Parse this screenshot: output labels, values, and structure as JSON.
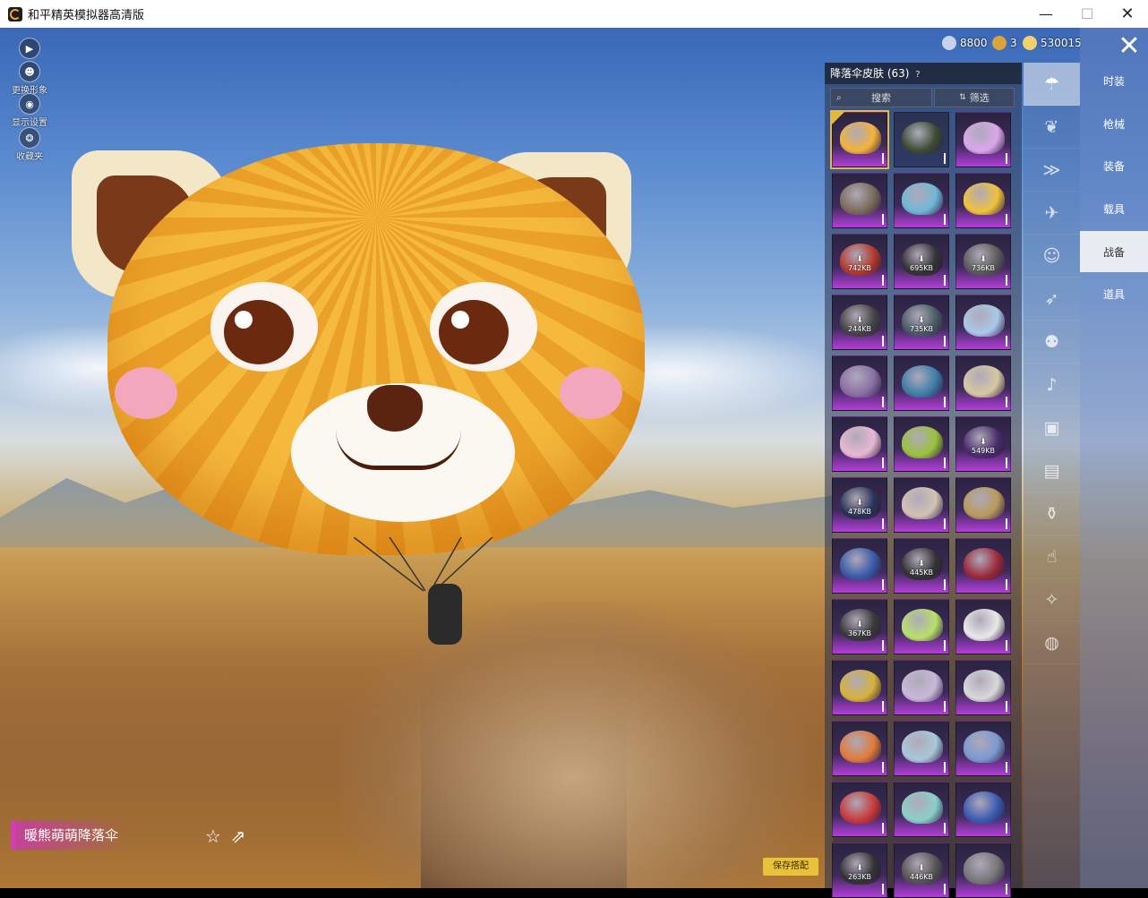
{
  "window": {
    "title": "和平精英模拟器高清版"
  },
  "currencies": [
    {
      "value": "8800",
      "color": "#c9d3e8"
    },
    {
      "value": "3",
      "color": "#d8a53a"
    },
    {
      "value": "530015",
      "color": "#f0d26a"
    }
  ],
  "left_tools": [
    {
      "label": "",
      "icon": "play-icon"
    },
    {
      "label": "更换形象",
      "icon": "person-icon"
    },
    {
      "label": "显示设置",
      "icon": "eye-icon"
    },
    {
      "label": "收藏夹",
      "icon": "badge-icon"
    }
  ],
  "panel": {
    "title": "降落伞皮肤 (63)",
    "help": "?",
    "search_label": "搜索",
    "filter_label": "筛选",
    "tiles": [
      {
        "size": "",
        "color": "#f2b33a",
        "selected": true
      },
      {
        "size": "",
        "color": "#3e4a33"
      },
      {
        "size": "",
        "color": "#d9a7e8"
      },
      {
        "size": "",
        "color": "#7a6b5a"
      },
      {
        "size": "",
        "color": "#6fb8d6"
      },
      {
        "size": "",
        "color": "#f0c23a"
      },
      {
        "size": "742KB",
        "color": "#b33a2e"
      },
      {
        "size": "695KB",
        "color": "#333"
      },
      {
        "size": "736KB",
        "color": "#5b5b5b"
      },
      {
        "size": "244KB",
        "color": "#444"
      },
      {
        "size": "735KB",
        "color": "#4a5c66"
      },
      {
        "size": "",
        "color": "#a8c8e8"
      },
      {
        "size": "",
        "color": "#8a6fa5"
      },
      {
        "size": "",
        "color": "#3e7ea8"
      },
      {
        "size": "",
        "color": "#d6c8a0"
      },
      {
        "size": "",
        "color": "#e8b7d2"
      },
      {
        "size": "",
        "color": "#9ac23a"
      },
      {
        "size": "549KB",
        "color": "#4a2d6b"
      },
      {
        "size": "478KB",
        "color": "#2a3355"
      },
      {
        "size": "",
        "color": "#d2c2b2"
      },
      {
        "size": "",
        "color": "#b89a5a"
      },
      {
        "size": "",
        "color": "#3a5aa8"
      },
      {
        "size": "445KB",
        "color": "#333"
      },
      {
        "size": "",
        "color": "#9a2a3a"
      },
      {
        "size": "367KB",
        "color": "#3a3a3a"
      },
      {
        "size": "",
        "color": "#b8e06a"
      },
      {
        "size": "",
        "color": "#e8e8e8"
      },
      {
        "size": "",
        "color": "#d6b23a"
      },
      {
        "size": "",
        "color": "#c8b8d8"
      },
      {
        "size": "",
        "color": "#d8d8d8"
      },
      {
        "size": "",
        "color": "#e07a3a"
      },
      {
        "size": "",
        "color": "#a8c8d8"
      },
      {
        "size": "",
        "color": "#7a9ad0"
      },
      {
        "size": "",
        "color": "#c83a3a"
      },
      {
        "size": "",
        "color": "#8ad0c8"
      },
      {
        "size": "",
        "color": "#3a5ab0"
      },
      {
        "size": "263KB",
        "color": "#333"
      },
      {
        "size": "446KB",
        "color": "#555"
      },
      {
        "size": "",
        "color": "#777"
      }
    ]
  },
  "rail": [
    {
      "icon": "parachute-icon",
      "active": true
    },
    {
      "icon": "wings-icon"
    },
    {
      "icon": "plane-trail-icon"
    },
    {
      "icon": "airplane-icon"
    },
    {
      "icon": "emote-icon"
    },
    {
      "icon": "glider-icon"
    },
    {
      "icon": "companion-icon"
    },
    {
      "icon": "speaker-icon"
    },
    {
      "icon": "box-icon"
    },
    {
      "icon": "gallery-icon"
    },
    {
      "icon": "extinguisher-icon"
    },
    {
      "icon": "tap-icon"
    },
    {
      "icon": "wand-icon"
    },
    {
      "icon": "ufo-icon"
    }
  ],
  "categories": [
    {
      "label": "时装"
    },
    {
      "label": "枪械"
    },
    {
      "label": "装备"
    },
    {
      "label": "载具"
    },
    {
      "label": "战备",
      "active": true
    },
    {
      "label": "道具"
    }
  ],
  "item_name": "暖熊萌萌降落伞",
  "save_label": "保存搭配"
}
